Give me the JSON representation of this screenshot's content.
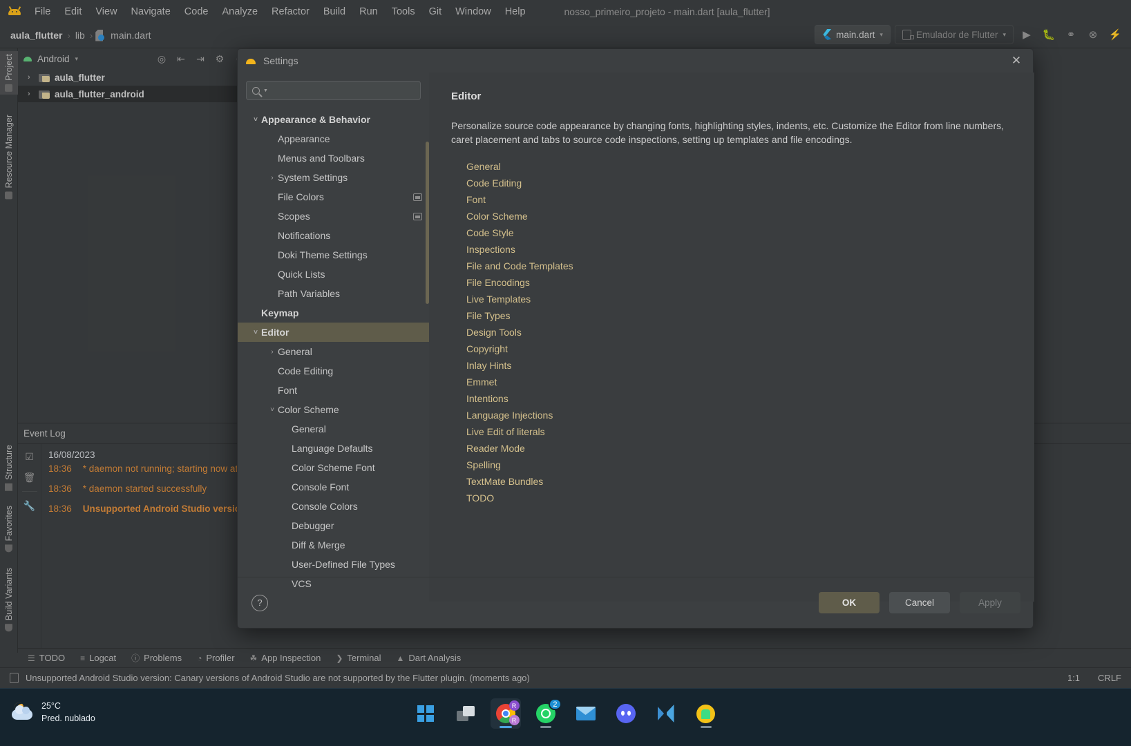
{
  "window": {
    "title": "nosso_primeiro_projeto - main.dart [aula_flutter]",
    "app_icon": "android-studio-icon"
  },
  "menubar": {
    "items": [
      {
        "label": "File"
      },
      {
        "label": "Edit"
      },
      {
        "label": "View"
      },
      {
        "label": "Navigate"
      },
      {
        "label": "Code"
      },
      {
        "label": "Analyze"
      },
      {
        "label": "Refactor"
      },
      {
        "label": "Build"
      },
      {
        "label": "Run"
      },
      {
        "label": "Tools"
      },
      {
        "label": "Git"
      },
      {
        "label": "Window"
      },
      {
        "label": "Help"
      }
    ]
  },
  "navbar": {
    "crumbs": [
      "aula_flutter",
      "lib",
      "main.dart"
    ],
    "separator": "›",
    "run_config": "main.dart",
    "device": "Emulador de Flutter",
    "caret": "▾",
    "actions": [
      "run-icon",
      "debug-icon",
      "profile-icon",
      "attach-icon",
      "hot-reload-icon"
    ]
  },
  "left_tool_strip": {
    "top": [
      {
        "label": "Project",
        "icon": "folder-icon",
        "selected": true
      },
      {
        "label": "Resource Manager",
        "icon": "resource-icon",
        "selected": false
      }
    ],
    "bottom": [
      {
        "label": "Structure",
        "icon": "structure-icon"
      },
      {
        "label": "Favorites",
        "icon": "heart-icon"
      },
      {
        "label": "Build Variants",
        "icon": "android-icon"
      }
    ]
  },
  "project_panel": {
    "scope": "Android",
    "scope_caret": "▾",
    "toolbar_icons": [
      "target-icon",
      "expand-all-icon",
      "collapse-all-icon",
      "gear-icon",
      "minimize-icon"
    ],
    "tree": [
      {
        "label": "aula_flutter",
        "chevron": "›"
      },
      {
        "label": "aula_flutter_android",
        "chevron": "›"
      }
    ]
  },
  "event_log": {
    "title": "Event Log",
    "tool_icons": [
      "mark-read-icon",
      "trash-icon",
      "settings-wrench-icon"
    ],
    "date": "16/08/2023",
    "entries": [
      {
        "time": "18:36",
        "message": "* daemon not running; starting now at",
        "bold": false
      },
      {
        "time": "18:36",
        "message": "* daemon started successfully",
        "bold": false
      },
      {
        "time": "18:36",
        "message": "Unsupported Android Studio version",
        "bold": true
      }
    ]
  },
  "bottom_toolbar": {
    "items": [
      {
        "label": "TODO",
        "icon": "todo-icon"
      },
      {
        "label": "Logcat",
        "icon": "logcat-icon"
      },
      {
        "label": "Problems",
        "icon": "problems-icon"
      },
      {
        "label": "Profiler",
        "icon": "profiler-icon"
      },
      {
        "label": "App Inspection",
        "icon": "app-inspection-icon"
      },
      {
        "label": "Terminal",
        "icon": "terminal-icon"
      },
      {
        "label": "Dart Analysis",
        "icon": "dart-analysis-icon"
      }
    ]
  },
  "statusbar": {
    "message": "Unsupported Android Studio version: Canary versions of Android Studio are not supported by the Flutter plugin. (moments ago)",
    "caret_position": "1:1",
    "line_separator": "CRLF"
  },
  "settings_dialog": {
    "title": "Settings",
    "close_label": "✕",
    "search_placeholder": "",
    "search_value": "",
    "tree": [
      {
        "label": "Appearance & Behavior",
        "level": 0,
        "chevron": "˅",
        "selected": false,
        "badge": false
      },
      {
        "label": "Appearance",
        "level": 1,
        "chevron": "",
        "selected": false,
        "badge": false
      },
      {
        "label": "Menus and Toolbars",
        "level": 1,
        "chevron": "",
        "selected": false,
        "badge": false
      },
      {
        "label": "System Settings",
        "level": 1,
        "chevron": "›",
        "selected": false,
        "badge": false
      },
      {
        "label": "File Colors",
        "level": 1,
        "chevron": "",
        "selected": false,
        "badge": true
      },
      {
        "label": "Scopes",
        "level": 1,
        "chevron": "",
        "selected": false,
        "badge": true
      },
      {
        "label": "Notifications",
        "level": 1,
        "chevron": "",
        "selected": false,
        "badge": false
      },
      {
        "label": "Doki Theme Settings",
        "level": 1,
        "chevron": "",
        "selected": false,
        "badge": false
      },
      {
        "label": "Quick Lists",
        "level": 1,
        "chevron": "",
        "selected": false,
        "badge": false
      },
      {
        "label": "Path Variables",
        "level": 1,
        "chevron": "",
        "selected": false,
        "badge": false
      },
      {
        "label": "Keymap",
        "level": 0,
        "chevron": "",
        "selected": false,
        "badge": false
      },
      {
        "label": "Editor",
        "level": 0,
        "chevron": "˅",
        "selected": true,
        "badge": false
      },
      {
        "label": "General",
        "level": 1,
        "chevron": "›",
        "selected": false,
        "badge": false
      },
      {
        "label": "Code Editing",
        "level": 1,
        "chevron": "",
        "selected": false,
        "badge": false
      },
      {
        "label": "Font",
        "level": 1,
        "chevron": "",
        "selected": false,
        "badge": false
      },
      {
        "label": "Color Scheme",
        "level": 1,
        "chevron": "˅",
        "selected": false,
        "badge": false
      },
      {
        "label": "General",
        "level": 2,
        "chevron": "",
        "selected": false,
        "badge": false
      },
      {
        "label": "Language Defaults",
        "level": 2,
        "chevron": "",
        "selected": false,
        "badge": false
      },
      {
        "label": "Color Scheme Font",
        "level": 2,
        "chevron": "",
        "selected": false,
        "badge": false
      },
      {
        "label": "Console Font",
        "level": 2,
        "chevron": "",
        "selected": false,
        "badge": false
      },
      {
        "label": "Console Colors",
        "level": 2,
        "chevron": "",
        "selected": false,
        "badge": false
      },
      {
        "label": "Debugger",
        "level": 2,
        "chevron": "",
        "selected": false,
        "badge": false
      },
      {
        "label": "Diff & Merge",
        "level": 2,
        "chevron": "",
        "selected": false,
        "badge": false
      },
      {
        "label": "User-Defined File Types",
        "level": 2,
        "chevron": "",
        "selected": false,
        "badge": false
      },
      {
        "label": "VCS",
        "level": 2,
        "chevron": "",
        "selected": false,
        "badge": false
      }
    ],
    "detail": {
      "heading": "Editor",
      "description": "Personalize source code appearance by changing fonts, highlighting styles, indents, etc. Customize the Editor from line numbers, caret placement and tabs to source code inspections, setting up templates and file encodings.",
      "links": [
        "General",
        "Code Editing",
        "Font",
        "Color Scheme",
        "Code Style",
        "Inspections",
        "File and Code Templates",
        "File Encodings",
        "Live Templates",
        "File Types",
        "Design Tools",
        "Copyright",
        "Inlay Hints",
        "Emmet",
        "Intentions",
        "Language Injections",
        "Live Edit of literals",
        "Reader Mode",
        "Spelling",
        "TextMate Bundles",
        "TODO"
      ]
    },
    "footer": {
      "help_label": "?",
      "ok_label": "OK",
      "cancel_label": "Cancel",
      "apply_label": "Apply"
    }
  },
  "taskbar": {
    "weather": {
      "temperature": "25°C",
      "condition": "Pred. nublado",
      "icon": "moon-cloud-icon"
    },
    "apps": [
      {
        "name": "start-button",
        "icon": "windows-logo-icon",
        "active": false,
        "badge": ""
      },
      {
        "name": "task-view-button",
        "icon": "task-view-icon",
        "active": false,
        "badge": ""
      },
      {
        "name": "chrome-button",
        "icon": "chrome-icon",
        "active": true,
        "badge": ""
      },
      {
        "name": "whatsapp-button",
        "icon": "whatsapp-icon",
        "active": false,
        "badge": "2"
      },
      {
        "name": "mail-button",
        "icon": "mail-icon",
        "active": false,
        "badge": ""
      },
      {
        "name": "discord-button",
        "icon": "discord-icon",
        "active": false,
        "badge": ""
      },
      {
        "name": "vscode-button",
        "icon": "vscode-icon",
        "active": false,
        "badge": ""
      },
      {
        "name": "android-studio-button",
        "icon": "android-studio-icon",
        "active": false,
        "badge": ""
      }
    ]
  },
  "colors": {
    "accent": "#d4c08c",
    "selection": "#5f5c4a",
    "panel": "#3c3f41",
    "log_orange": "#d98a3b"
  }
}
